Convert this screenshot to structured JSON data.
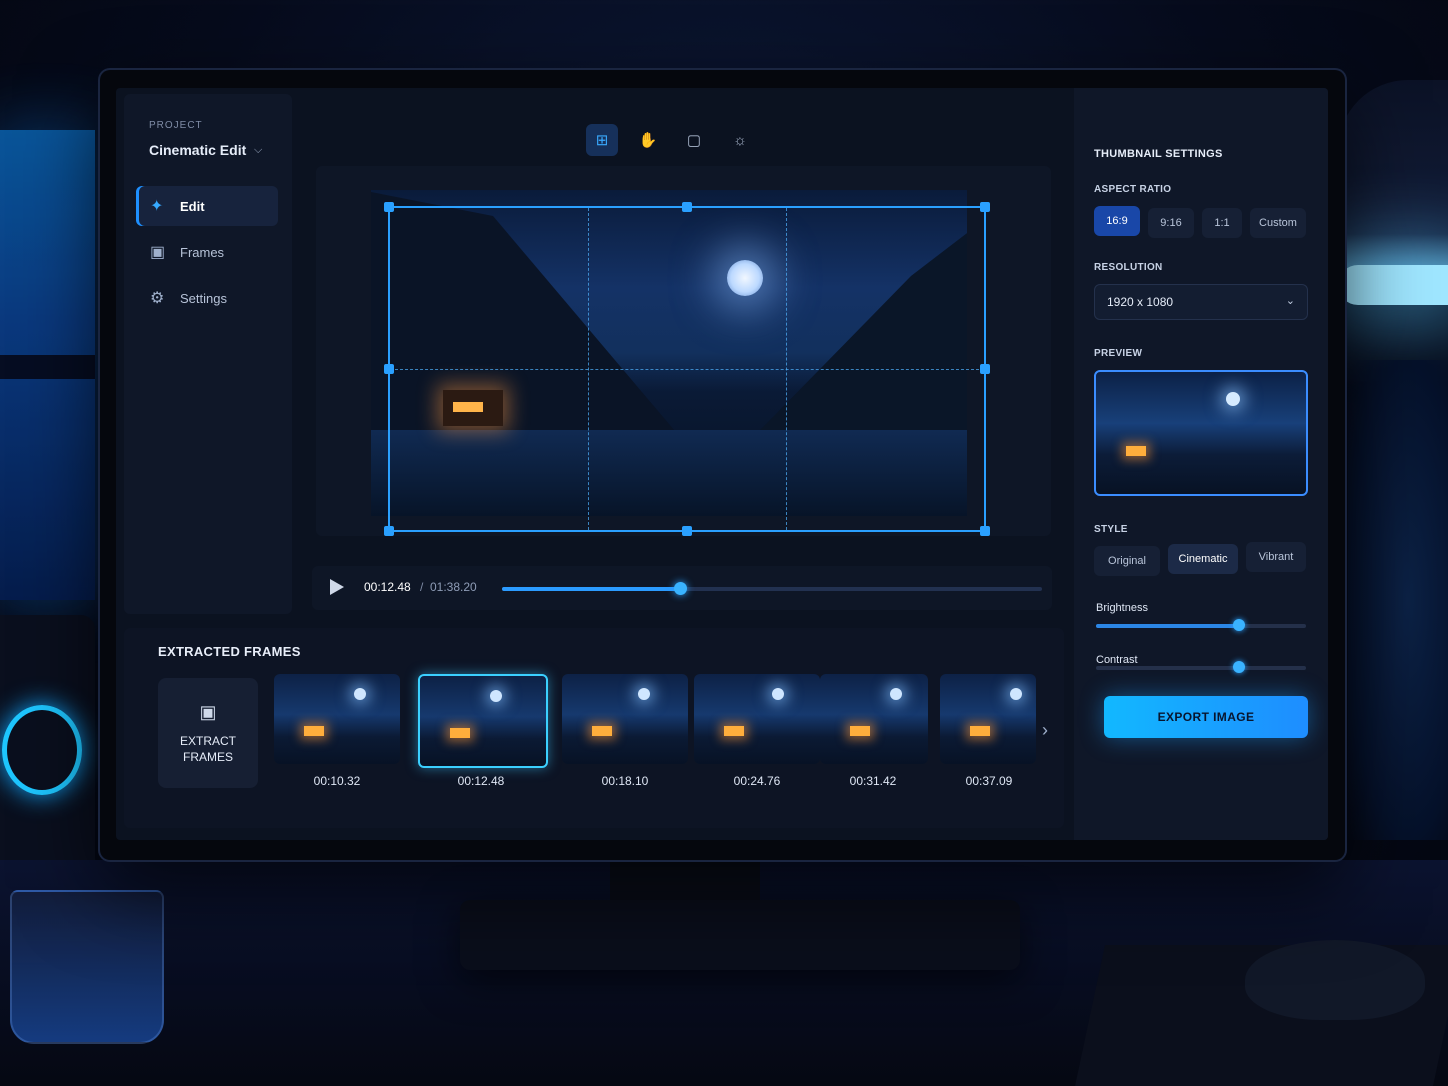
{
  "project": {
    "label": "PROJECT",
    "name": "Cinematic Edit"
  },
  "nav": [
    {
      "label": "Edit",
      "icon": "magic-wand-icon",
      "active": true
    },
    {
      "label": "Frames",
      "icon": "frames-icon",
      "active": false
    },
    {
      "label": "Settings",
      "icon": "gear-icon",
      "active": false
    }
  ],
  "toolbar": {
    "tools": [
      "crop-icon",
      "hand-icon",
      "frame-capture-icon",
      "brightness-icon"
    ],
    "active": "crop-icon"
  },
  "playback": {
    "current": "00:12.48",
    "separator": "/",
    "total": "01:38.20",
    "progress": 0.33
  },
  "frames": {
    "title": "EXTRACTED FRAMES",
    "extract_label": "EXTRACT FRAMES",
    "items": [
      {
        "time": "00:10.32",
        "selected": false
      },
      {
        "time": "00:12.48",
        "selected": true
      },
      {
        "time": "00:18.10",
        "selected": false
      },
      {
        "time": "00:24.76",
        "selected": false
      },
      {
        "time": "00:31.42",
        "selected": false
      },
      {
        "time": "00:37.09",
        "selected": false
      }
    ]
  },
  "settings": {
    "title": "THUMBNAIL SETTINGS",
    "aspect_label": "ASPECT RATIO",
    "aspect_options": [
      "16:9",
      "9:16",
      "1:1",
      "Custom"
    ],
    "aspect_selected": "16:9",
    "resolution_label": "RESOLUTION",
    "resolution_value": "1920 x 1080",
    "preview_label": "PREVIEW",
    "style_label": "STYLE",
    "style_options": [
      "Original",
      "Cinematic",
      "Vibrant"
    ],
    "style_selected": "Cinematic",
    "brightness_label": "Brightness",
    "brightness_value": 0.68,
    "contrast_label": "Contrast",
    "contrast_value": 0.68,
    "export_label": "EXPORT IMAGE"
  },
  "colors": {
    "accent": "#2aa0ff",
    "export_start": "#12b8ff",
    "export_end": "#1e8dff",
    "active_segment": "#1947a8"
  }
}
